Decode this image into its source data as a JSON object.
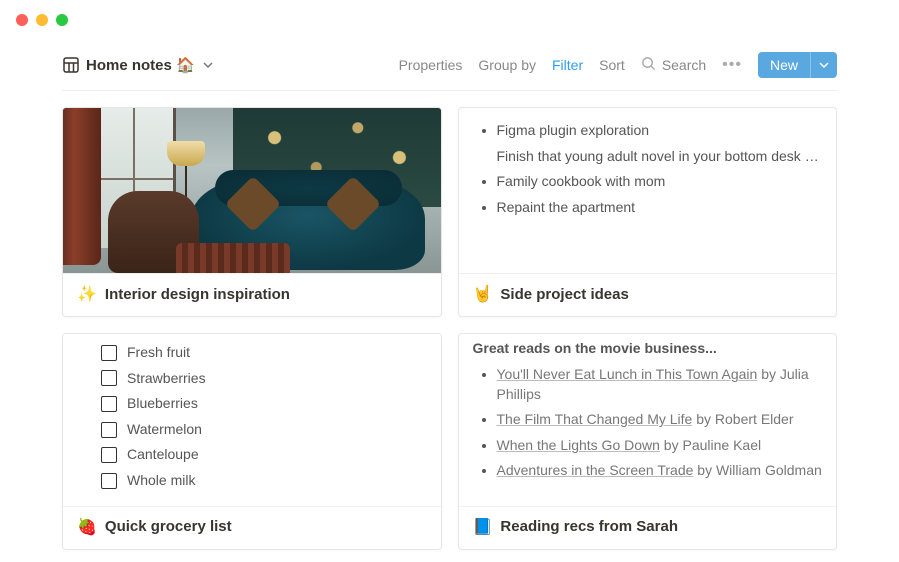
{
  "header": {
    "title": "Home notes 🏠",
    "links": {
      "properties": "Properties",
      "group_by": "Group by",
      "filter": "Filter",
      "sort": "Sort",
      "search": "Search"
    },
    "new_button": "New"
  },
  "cards": {
    "interior": {
      "title_emoji": "✨",
      "title": "Interior design inspiration"
    },
    "side_projects": {
      "title_emoji": "🤘",
      "title": "Side project ideas",
      "items": [
        "Figma plugin exploration",
        "Finish that young adult novel in your bottom desk drawer...",
        "Family cookbook with mom",
        "Repaint the apartment"
      ]
    },
    "grocery": {
      "title_emoji": "🍓",
      "title": "Quick grocery list",
      "items": [
        "Fresh fruit",
        "Strawberries",
        "Blueberries",
        "Watermelon",
        "Canteloupe",
        "Whole milk"
      ]
    },
    "reading": {
      "title_emoji": "📘",
      "title": "Reading recs from Sarah",
      "subhead": "Great reads on the movie business...",
      "items": [
        {
          "link": "You'll Never Eat Lunch in This Town Again",
          "by": " by Julia Phillips"
        },
        {
          "link": "The Film That Changed My Life",
          "by": " by Robert Elder"
        },
        {
          "link": "When the Lights Go Down",
          "by": " by Pauline Kael"
        },
        {
          "link": "Adventures in the Screen Trade",
          "by": " by William Goldman"
        }
      ]
    }
  }
}
